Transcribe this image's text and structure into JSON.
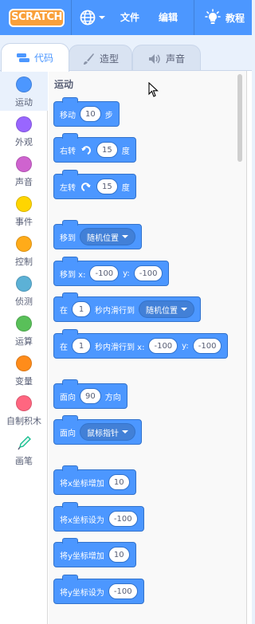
{
  "menubar": {
    "logo": "SCRATCH",
    "file": "文件",
    "edit": "编辑",
    "tutorial": "教程"
  },
  "tabs": [
    {
      "label": "代码"
    },
    {
      "label": "造型"
    },
    {
      "label": "声音"
    }
  ],
  "categories": [
    {
      "label": "运动",
      "color": "#4c97ff"
    },
    {
      "label": "外观",
      "color": "#9966ff"
    },
    {
      "label": "声音",
      "color": "#cf63cf"
    },
    {
      "label": "事件",
      "color": "#ffd500"
    },
    {
      "label": "控制",
      "color": "#ffab19"
    },
    {
      "label": "侦测",
      "color": "#5cb1d6"
    },
    {
      "label": "运算",
      "color": "#59c059"
    },
    {
      "label": "变量",
      "color": "#ff8c1a"
    },
    {
      "label": "自制积木",
      "color": "#ff6680"
    },
    {
      "label": "画笔",
      "color": "#0fbd8c"
    }
  ],
  "palette": {
    "heading": "运动",
    "blocks": {
      "move": {
        "pre": "移动",
        "val": "10",
        "post": "步"
      },
      "turn_right": {
        "pre": "右转",
        "val": "15",
        "post": "度"
      },
      "turn_left": {
        "pre": "左转",
        "val": "15",
        "post": "度"
      },
      "goto": {
        "pre": "移到",
        "drop": "随机位置"
      },
      "goto_xy": {
        "pre": "移到 x:",
        "x": "-100",
        "ylabel": "y:",
        "y": "-100"
      },
      "glide": {
        "pre": "在",
        "val": "1",
        "mid": "秒内滑行到",
        "drop": "随机位置"
      },
      "glide_xy": {
        "pre": "在",
        "val": "1",
        "mid": "秒内滑行到 x:",
        "x": "-100",
        "ylabel": "y:",
        "y": "-100"
      },
      "point": {
        "pre": "面向",
        "val": "90",
        "post": "方向"
      },
      "point_towards": {
        "pre": "面向",
        "drop": "鼠标指针"
      },
      "change_x": {
        "pre": "将x坐标增加",
        "val": "10"
      },
      "set_x": {
        "pre": "将x坐标设为",
        "val": "-100"
      },
      "change_y": {
        "pre": "将y坐标增加",
        "val": "10"
      },
      "set_y": {
        "pre": "将y坐标设为",
        "val": "-100"
      }
    }
  }
}
